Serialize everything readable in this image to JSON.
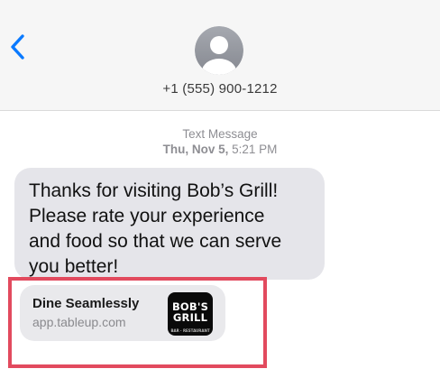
{
  "header": {
    "contact_number": "+1 (555) 900-1212",
    "back_icon": "chevron-left-icon",
    "avatar_icon": "person-icon",
    "accent_color": "#0a7aff"
  },
  "thread": {
    "message_type": "Text Message",
    "day": "Thu, Nov 5,",
    "time": "5:21 PM"
  },
  "message": {
    "text": "Thanks for visiting Bob’s Grill!\nPlease rate your experience\nand food so that we can serve\nyou better!"
  },
  "link_preview": {
    "title": "Dine Seamlessly",
    "url": "app.tableup.com",
    "logo_line1": "BOB'S",
    "logo_line2": "GRILL",
    "logo_subtext": "BAR · RESTAURANT"
  },
  "annotation": {
    "highlight_color": "#e24a5e"
  }
}
